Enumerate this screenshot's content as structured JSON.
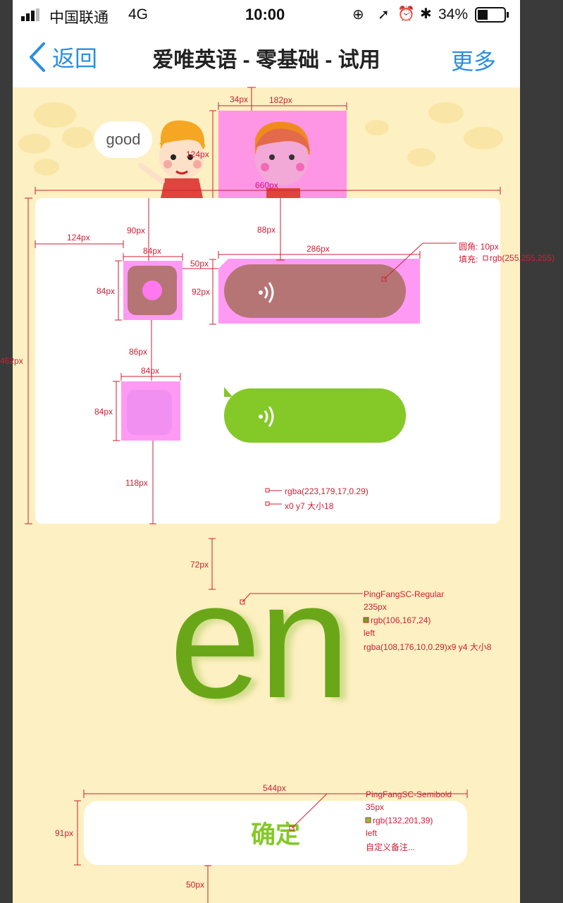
{
  "status_bar": {
    "carrier": "中国联通",
    "network": "4G",
    "time": "10:00",
    "battery": "34%"
  },
  "nav": {
    "back_label": "返回",
    "title": "爱唯英语 - 零基础 - 试用",
    "more_label": "更多"
  },
  "speech_bubble_text": "good",
  "letters": "en",
  "confirm_label": "确定",
  "annotations": {
    "w34": "34px",
    "w182": "182px",
    "h124": "124px",
    "w660": "660px",
    "l124": "124px",
    "v90": "90px",
    "v88": "88px",
    "w84a": "84px",
    "w286": "286px",
    "g50": "50px",
    "h84a": "84px",
    "h92": "92px",
    "h462": "462px",
    "v86": "86px",
    "w84b": "84px",
    "h84b": "84px",
    "v118": "118px",
    "v72": "72px",
    "w544": "544px",
    "h91": "91px",
    "v50": "50px",
    "radius_label": "圆角:  10px",
    "fill_label": "填充:  ",
    "fill_value": "rgb(255,255,255)",
    "shadow_color": "rgba(223,179,17,0.29)",
    "shadow_offset": "x0 y7 大小18",
    "en_font": "PingFangSC-Regular",
    "en_size": "235px",
    "en_color": "rgb(106,167,24)",
    "en_align": "left",
    "en_shadow": "rgba(108,176,10,0.29)x9 y4 大小8",
    "btn_font": "PingFangSC-Semibold",
    "btn_size": "35px",
    "btn_color": "rgb(132,201,39)",
    "btn_align": "left",
    "btn_note": "自定义备注..."
  },
  "colors": {
    "accent_green": "#84c927",
    "letter_green": "#6aa718",
    "nav_blue": "#2a8fe0",
    "background": "#fdf0c2",
    "measure_red": "#cc1f36",
    "highlight": "#ff78f0"
  }
}
